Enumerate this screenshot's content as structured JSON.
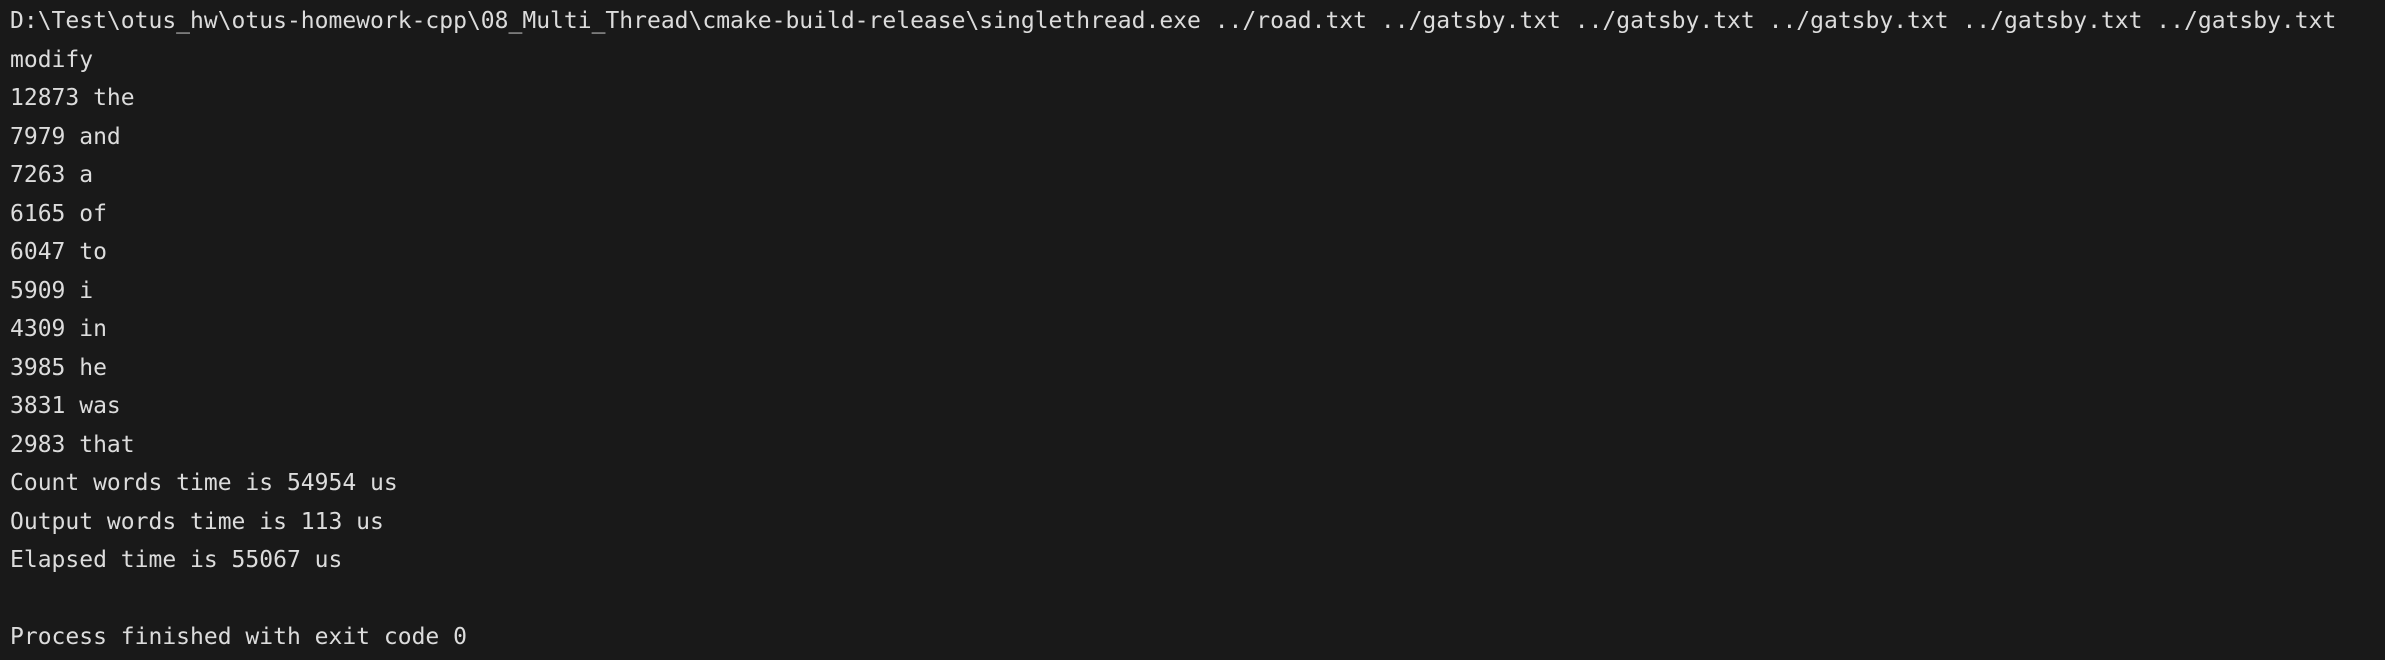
{
  "console": {
    "command": "D:\\Test\\otus_hw\\otus-homework-cpp\\08_Multi_Thread\\cmake-build-release\\singlethread.exe ../road.txt ../gatsby.txt ../gatsby.txt ../gatsby.txt ../gatsby.txt ../gatsby.txt",
    "mode": "modify",
    "word_counts": [
      "12873 the",
      "7979 and",
      "7263 a",
      "6165 of",
      "6047 to",
      "5909 i",
      "4309 in",
      "3985 he",
      "3831 was",
      "2983 that"
    ],
    "timings": [
      "Count words time is 54954 us",
      "Output words time is 113 us",
      "Elapsed time is 55067 us"
    ],
    "exit_message": "Process finished with exit code 0"
  },
  "colors": {
    "background": "#191919",
    "text": "#dcdcdc"
  }
}
